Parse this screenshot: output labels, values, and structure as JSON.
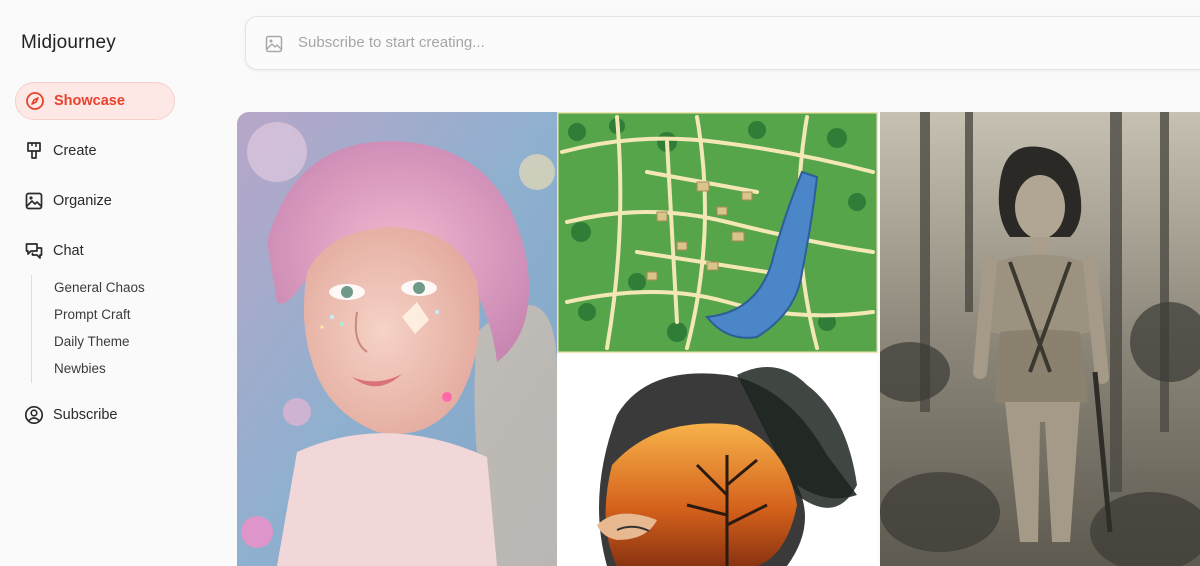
{
  "app": {
    "title": "Midjourney"
  },
  "sidebar": {
    "items": [
      {
        "label": "Showcase",
        "icon": "compass-icon",
        "active": true
      },
      {
        "label": "Create",
        "icon": "brush-icon"
      },
      {
        "label": "Organize",
        "icon": "image-icon"
      },
      {
        "label": "Chat",
        "icon": "chat-bubbles-icon"
      },
      {
        "label": "Subscribe",
        "icon": "user-circle-icon"
      }
    ],
    "chat_channels": [
      "General Chaos",
      "Prompt Craft",
      "Daily Theme",
      "Newbies"
    ]
  },
  "prompt_bar": {
    "icon": "image-icon",
    "placeholder": "Subscribe to start creating..."
  },
  "gallery": {
    "images": [
      {
        "subject": "pink-haired fairy portrait with glitter makeup"
      },
      {
        "subject": "illustrated top-down town map with river"
      },
      {
        "subject": "double exposure of face and burning tree"
      },
      {
        "subject": "vintage sepia photo of woman in jungle"
      }
    ]
  },
  "colors": {
    "accent": "#e8422d",
    "active_bg": "#fde8e6",
    "page_bg": "#fafafa"
  }
}
